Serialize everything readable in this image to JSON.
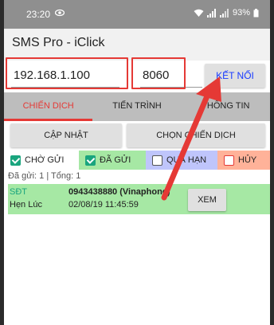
{
  "status_bar": {
    "time": "23:20",
    "battery": "93%"
  },
  "app": {
    "title": "SMS Pro - iClick"
  },
  "connection": {
    "ip": "192.168.1.100",
    "port": "8060",
    "connect_label": "KẾT NỐI"
  },
  "tabs": [
    {
      "label": "CHIẾN DỊCH",
      "active": true
    },
    {
      "label": "TIẾN TRÌNH",
      "active": false
    },
    {
      "label": "THÔNG TIN",
      "active": false
    }
  ],
  "actions": {
    "update_label": "CẬP NHẬT",
    "choose_label": "CHỌN CHIẾN DỊCH"
  },
  "filters": [
    {
      "label": "CHỜ GỬI",
      "checked": true,
      "color": "#ffffff"
    },
    {
      "label": "ĐÃ GỬI",
      "checked": true,
      "color": "#a6e8a4"
    },
    {
      "label": "QUÁ HẠN",
      "checked": false,
      "color": "#bfc5fb"
    },
    {
      "label": "HỦY",
      "checked": false,
      "color": "#ffb299"
    }
  ],
  "summary": "Đã gửi: 1 | Tổng: 1",
  "messages": [
    {
      "phone_label": "SĐT",
      "phone_value": "0943438880 (Vinaphone)",
      "schedule_label": "Hẹn Lúc",
      "schedule_value": "02/08/19 11:45:59",
      "view_label": "XEM"
    }
  ],
  "colors": {
    "accent": "#e53935",
    "sent": "#a6e8a4",
    "link": "#1a3cff"
  }
}
